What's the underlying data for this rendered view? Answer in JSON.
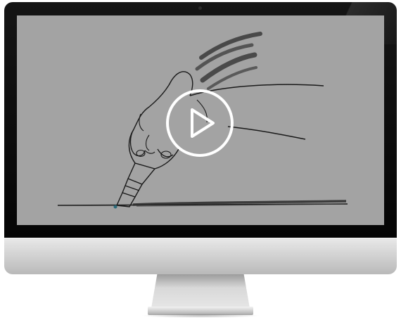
{
  "colors": {
    "screen_background": "#a3a3a3",
    "bezel": "#0a0a0a",
    "play_icon": "#ffffff",
    "sketch_line": "#1a1a1a",
    "chin": "#d8d8d8"
  },
  "icons": {
    "play": "play-icon",
    "illustration": "hand-drawing-with-marker-illustration"
  }
}
